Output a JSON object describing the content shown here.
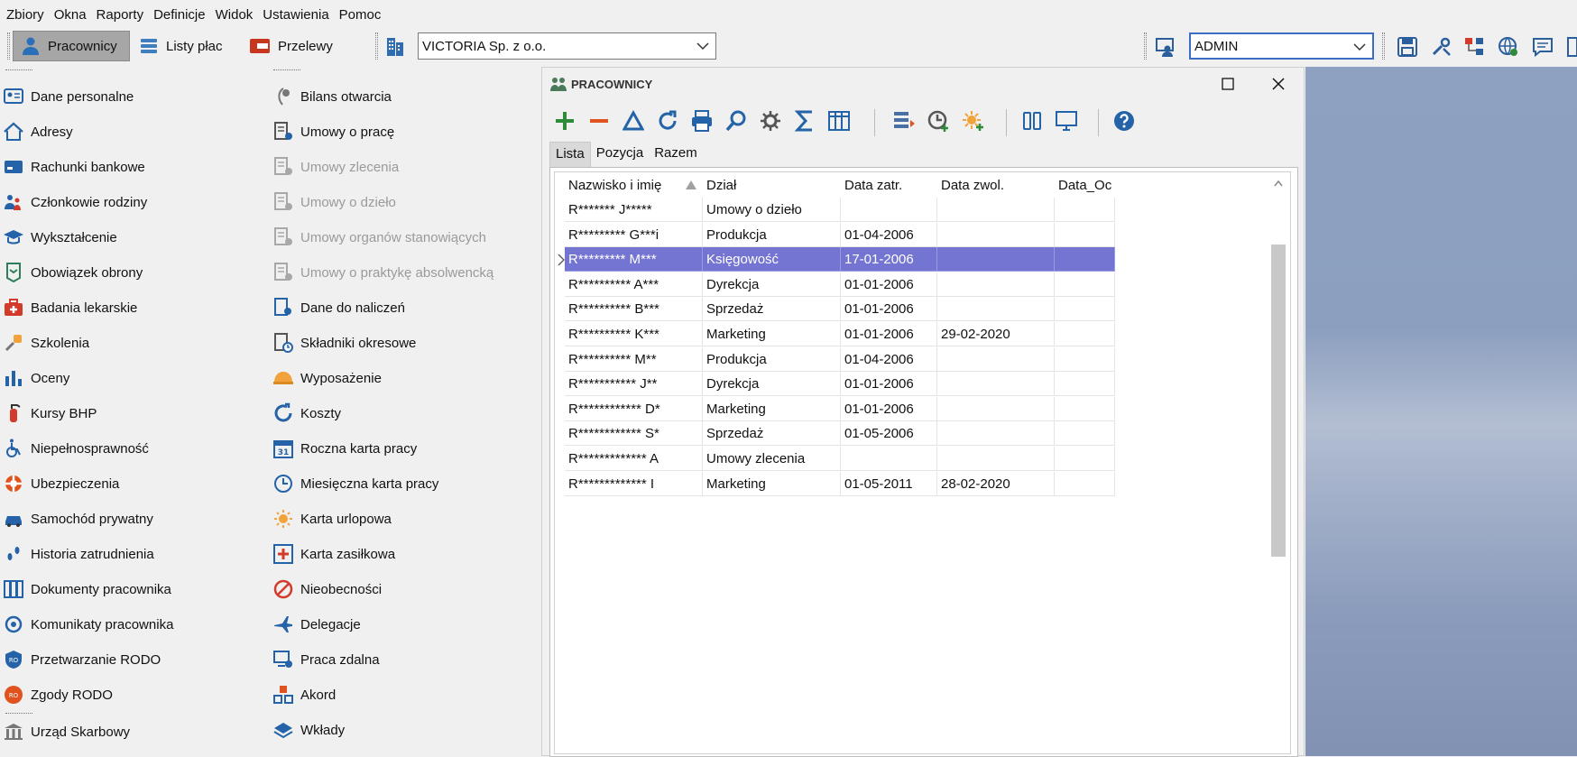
{
  "menu": [
    "Zbiory",
    "Okna",
    "Raporty",
    "Definicje",
    "Widok",
    "Ustawienia",
    "Pomoc"
  ],
  "toolbar": {
    "modules": [
      {
        "label": "Pracownicy",
        "icon": "user-icon",
        "active": true
      },
      {
        "label": "Listy płac",
        "icon": "list-icon",
        "active": false
      },
      {
        "label": "Przelewy",
        "icon": "transfer-icon",
        "active": false
      }
    ],
    "company": "VICTORIA Sp. z o.o.",
    "user": "ADMIN"
  },
  "left_menu": [
    {
      "label": "Dane personalne",
      "icon": "id-card-icon"
    },
    {
      "label": "Adresy",
      "icon": "home-icon"
    },
    {
      "label": "Rachunki bankowe",
      "icon": "bank-card-icon"
    },
    {
      "label": "Członkowie rodziny",
      "icon": "family-icon"
    },
    {
      "label": "Wykształcenie",
      "icon": "graduation-cap-icon"
    },
    {
      "label": "Obowiązek obrony",
      "icon": "military-badge-icon"
    },
    {
      "label": "Badania lekarskie",
      "icon": "medical-kit-icon"
    },
    {
      "label": "Szkolenia",
      "icon": "training-icon"
    },
    {
      "label": "Oceny",
      "icon": "bar-chart-icon"
    },
    {
      "label": "Kursy BHP",
      "icon": "fire-extinguisher-icon"
    },
    {
      "label": "Niepełnosprawność",
      "icon": "wheelchair-icon"
    },
    {
      "label": "Ubezpieczenia",
      "icon": "lifebuoy-icon"
    },
    {
      "label": "Samochód prywatny",
      "icon": "car-icon"
    },
    {
      "label": "Historia zatrudnienia",
      "icon": "footsteps-icon"
    },
    {
      "label": "Dokumenty pracownika",
      "icon": "documents-icon"
    },
    {
      "label": "Komunikaty pracownika",
      "icon": "message-icon"
    },
    {
      "label": "Przetwarzanie RODO",
      "icon": "rodo-shield-icon"
    },
    {
      "label": "Zgody RODO",
      "icon": "rodo-consent-icon"
    },
    {
      "label": "Urząd Skarbowy",
      "icon": "tax-office-icon"
    }
  ],
  "mid_menu": [
    {
      "label": "Bilans otwarcia",
      "icon": "balance-icon",
      "disabled": false
    },
    {
      "label": "Umowy o pracę",
      "icon": "contract-icon",
      "disabled": false
    },
    {
      "label": "Umowy zlecenia",
      "icon": "contract-icon",
      "disabled": true
    },
    {
      "label": "Umowy o dzieło",
      "icon": "contract-icon",
      "disabled": true
    },
    {
      "label": "Umowy organów stanowiących",
      "icon": "contract-icon",
      "disabled": true
    },
    {
      "label": "Umowy o praktykę absolwencką",
      "icon": "contract-icon",
      "disabled": true
    },
    {
      "label": "Dane do naliczeń",
      "icon": "calc-data-icon",
      "disabled": false
    },
    {
      "label": "Składniki okresowe",
      "icon": "periodic-icon",
      "disabled": false
    },
    {
      "label": "Wyposażenie",
      "icon": "helmet-icon",
      "disabled": false
    },
    {
      "label": "Koszty",
      "icon": "cycle-icon",
      "disabled": false
    },
    {
      "label": "Roczna karta pracy",
      "icon": "calendar-icon",
      "disabled": false
    },
    {
      "label": "Miesięczna karta pracy",
      "icon": "clock-icon",
      "disabled": false
    },
    {
      "label": "Karta urlopowa",
      "icon": "sun-icon",
      "disabled": false
    },
    {
      "label": "Karta zasiłkowa",
      "icon": "medical-plus-icon",
      "disabled": false
    },
    {
      "label": "Nieobecności",
      "icon": "absence-icon",
      "disabled": false
    },
    {
      "label": "Delegacje",
      "icon": "airplane-icon",
      "disabled": false
    },
    {
      "label": "Praca zdalna",
      "icon": "remote-work-icon",
      "disabled": false
    },
    {
      "label": "Akord",
      "icon": "blocks-icon",
      "disabled": false
    },
    {
      "label": "Wkłady",
      "icon": "deposit-icon",
      "disabled": false
    }
  ],
  "window": {
    "title": "PRACOWNICY",
    "tabs": [
      "Lista",
      "Pozycja",
      "Razem"
    ],
    "active_tab": 0,
    "columns": [
      "Nazwisko i imię",
      "Dział",
      "Data zatr.",
      "Data zwol.",
      "Data_Oc"
    ],
    "rows": [
      [
        "R******* J*****",
        "Umowy o dzieło",
        "",
        "",
        ""
      ],
      [
        "R********* G***i",
        "Produkcja",
        "01-04-2006",
        "",
        ""
      ],
      [
        "R********* M***",
        "Księgowość",
        "17-01-2006",
        "",
        ""
      ],
      [
        "R********** A***",
        "Dyrekcja",
        "01-01-2006",
        "",
        ""
      ],
      [
        "R********** B***",
        "Sprzedaż",
        "01-01-2006",
        "",
        ""
      ],
      [
        "R********** K***",
        "Marketing",
        "01-01-2006",
        "29-02-2020",
        ""
      ],
      [
        "R********** M**",
        "Produkcja",
        "01-04-2006",
        "",
        ""
      ],
      [
        "R*********** J**",
        "Dyrekcja",
        "01-01-2006",
        "",
        ""
      ],
      [
        "R************ D*",
        "Marketing",
        "01-01-2006",
        "",
        ""
      ],
      [
        "R************ S*",
        "Sprzedaż",
        "01-05-2006",
        "",
        ""
      ],
      [
        "R************* A",
        "Umowy zlecenia",
        "",
        "",
        ""
      ],
      [
        "R************* I",
        "Marketing",
        "01-05-2011",
        "28-02-2020",
        ""
      ]
    ],
    "selected_row": 2
  },
  "colors": {
    "selection": "#7474d2",
    "accent": "#2e7d32",
    "minus": "#e0531e",
    "blue": "#2563a8"
  }
}
